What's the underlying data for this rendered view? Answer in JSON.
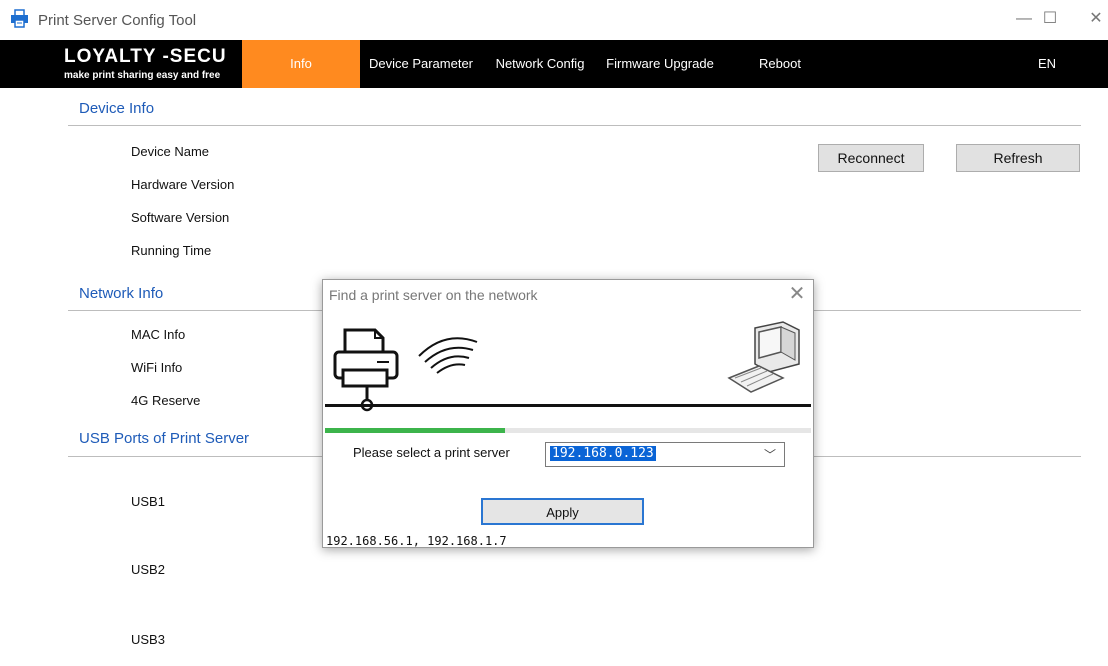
{
  "window": {
    "title": "Print Server Config Tool",
    "controls": {
      "minimize": "—",
      "maximize": "☐",
      "close": "✕"
    }
  },
  "nav": {
    "logo_title": "LOYALTY -SECU",
    "logo_subtitle": "make print sharing easy and free",
    "tabs": [
      {
        "label": "Info",
        "active": true
      },
      {
        "label": "Device Parameter",
        "active": false
      },
      {
        "label": "Network Config",
        "active": false
      },
      {
        "label": "Firmware Upgrade",
        "active": false
      },
      {
        "label": "Reboot",
        "active": false
      }
    ],
    "language": "EN",
    "accent_color": "#ff8a1f"
  },
  "device_info": {
    "title": "Device Info",
    "fields": [
      "Device Name",
      "Hardware Version",
      "Software Version",
      "Running Time"
    ],
    "reconnect_label": "Reconnect",
    "refresh_label": "Refresh"
  },
  "network_info": {
    "title": "Network Info",
    "fields": [
      "MAC Info",
      "WiFi Info",
      "4G Reserve"
    ]
  },
  "usb_ports": {
    "title": "USB Ports of Print Server",
    "ports": [
      "USB1",
      "USB2",
      "USB3"
    ]
  },
  "dialog": {
    "title": "Find a print server on the network",
    "close_icon": "close-icon",
    "icons": [
      "printer-icon",
      "wifi-icon",
      "computer-icon"
    ],
    "progress_fraction": 0.37,
    "progress_color": "#3cb44b",
    "select_label": "Please select a print server",
    "selected_server": "192.168.0.123",
    "apply_label": "Apply",
    "local_ips": "192.168.56.1, 192.168.1.7"
  }
}
